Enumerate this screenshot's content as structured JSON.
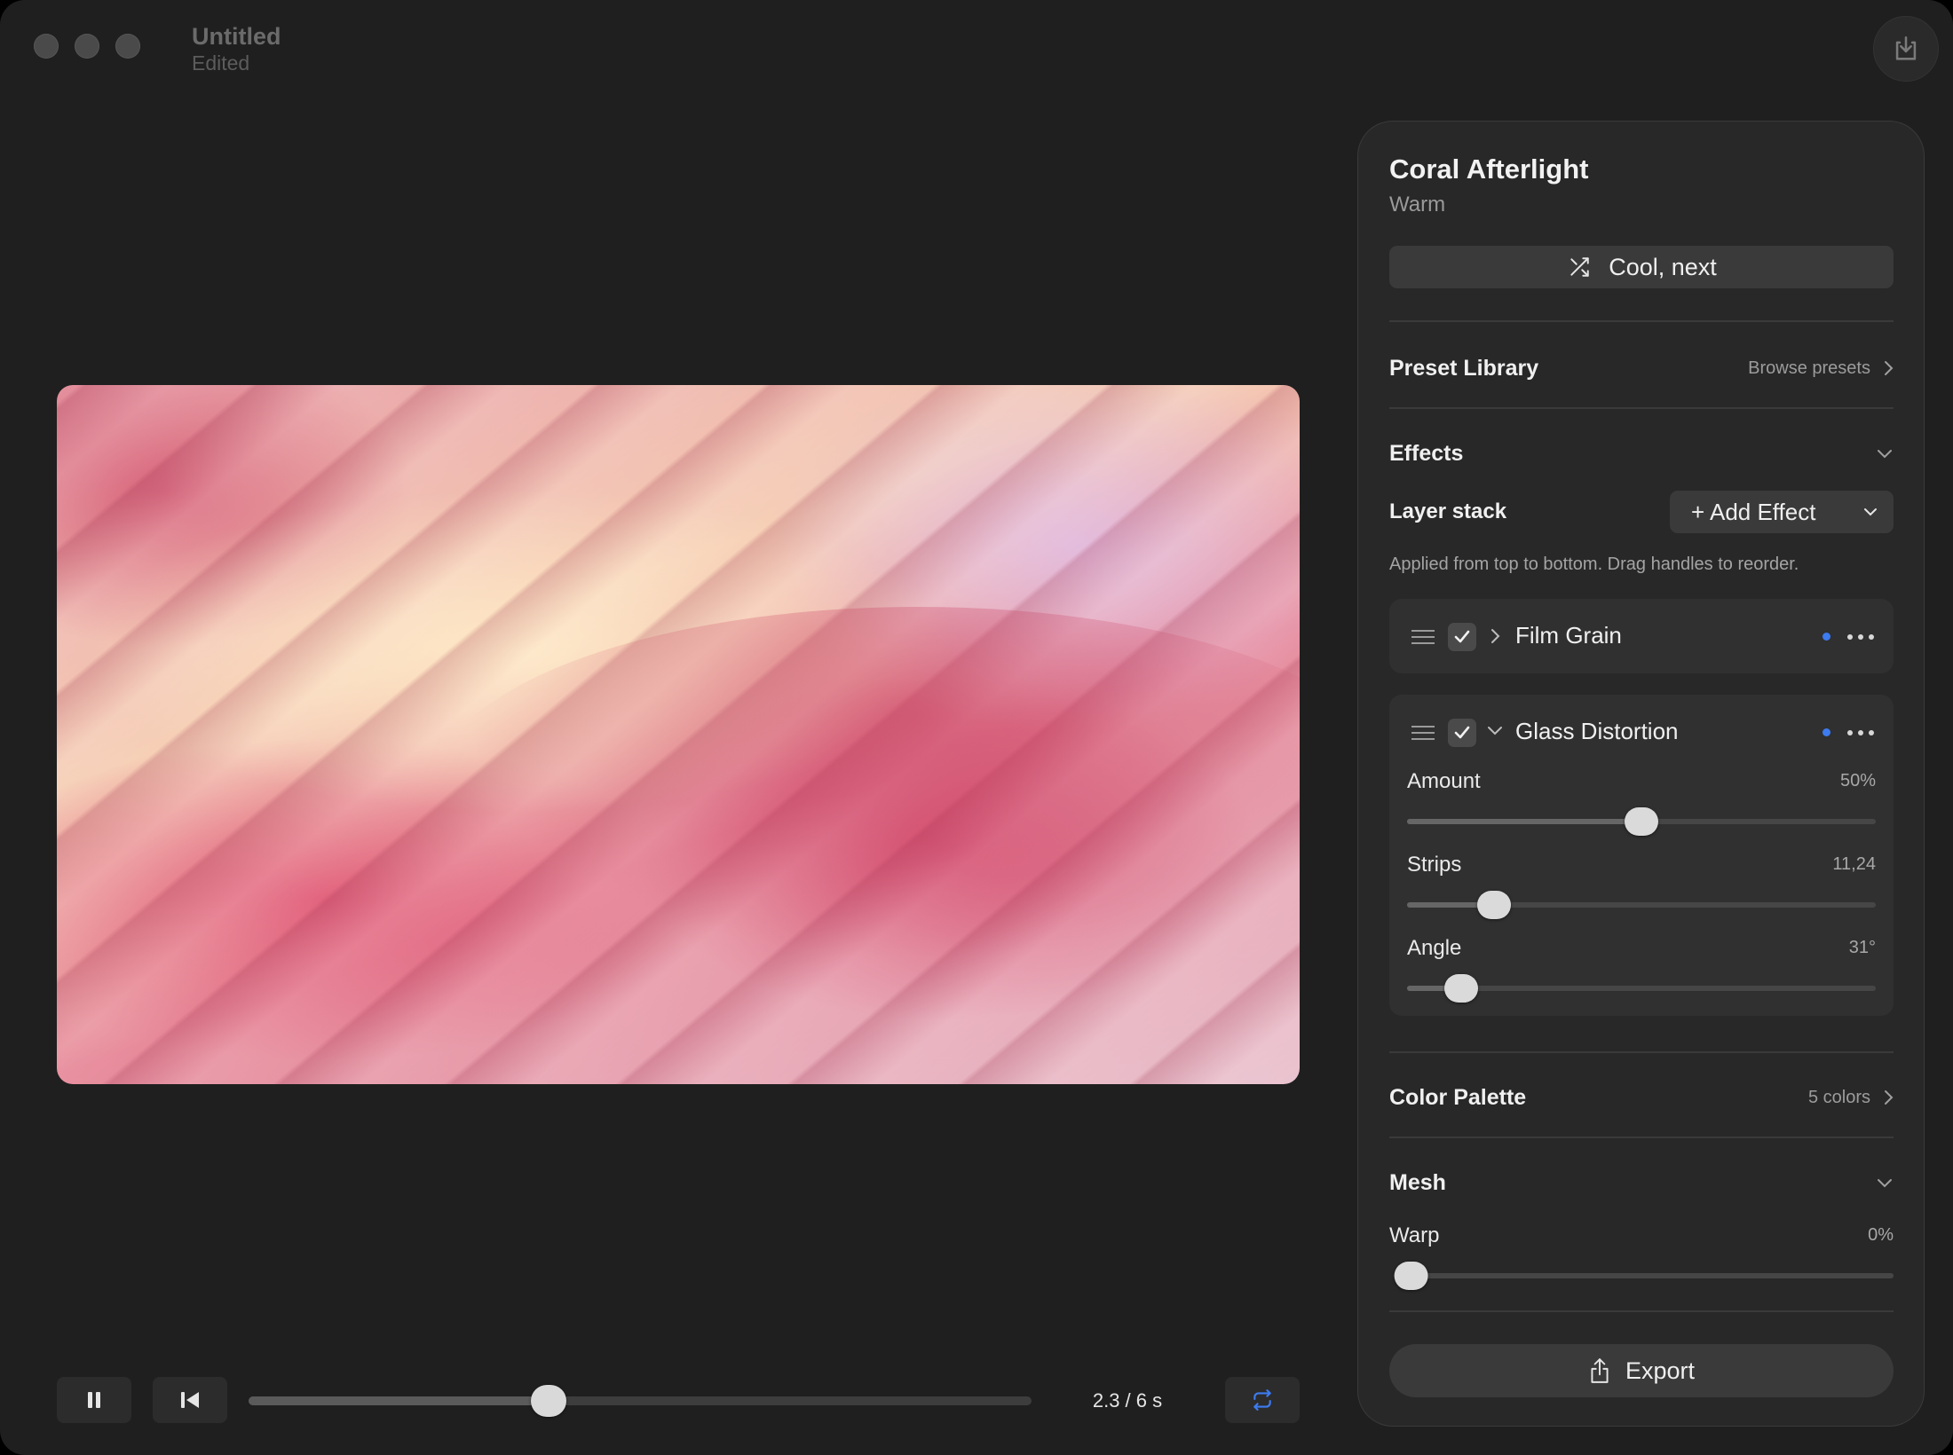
{
  "window": {
    "title": "Untitled",
    "subtitle": "Edited"
  },
  "icons": {
    "share": "download-tray-icon",
    "shuffle": "shuffle-icon",
    "pause": "pause-icon",
    "rewind": "skip-to-start-icon",
    "loop": "loop-icon",
    "export": "share-upload-icon"
  },
  "colors": {
    "accent": "#3d7bf0",
    "panel_bg": "#282828",
    "window_bg": "#1f1f1f"
  },
  "transport": {
    "time_label": "2.3 / 6 s",
    "progress": 0.383
  },
  "panel": {
    "title": "Coral Afterlight",
    "subtitle": "Warm",
    "shuffle_label": "Cool, next",
    "preset_library": {
      "title": "Preset Library",
      "link": "Browse presets"
    },
    "effects": {
      "title": "Effects",
      "layer_stack_label": "Layer stack",
      "add_effect_label": "+ Add Effect",
      "hint": "Applied from top to bottom. Drag handles to reorder.",
      "items": [
        {
          "name": "Film Grain",
          "enabled": true,
          "expanded": false
        },
        {
          "name": "Glass Distortion",
          "enabled": true,
          "expanded": true,
          "params": [
            {
              "label": "Amount",
              "value": "50%",
              "position": 0.5
            },
            {
              "label": "Strips",
              "value": "11,24",
              "position": 0.185
            },
            {
              "label": "Angle",
              "value": "31°",
              "position": 0.115
            }
          ]
        }
      ]
    },
    "color_palette": {
      "title": "Color Palette",
      "link": "5 colors"
    },
    "mesh": {
      "title": "Mesh",
      "params": [
        {
          "label": "Warp",
          "value": "0%",
          "position": 0.0
        }
      ]
    },
    "export_label": "Export"
  }
}
